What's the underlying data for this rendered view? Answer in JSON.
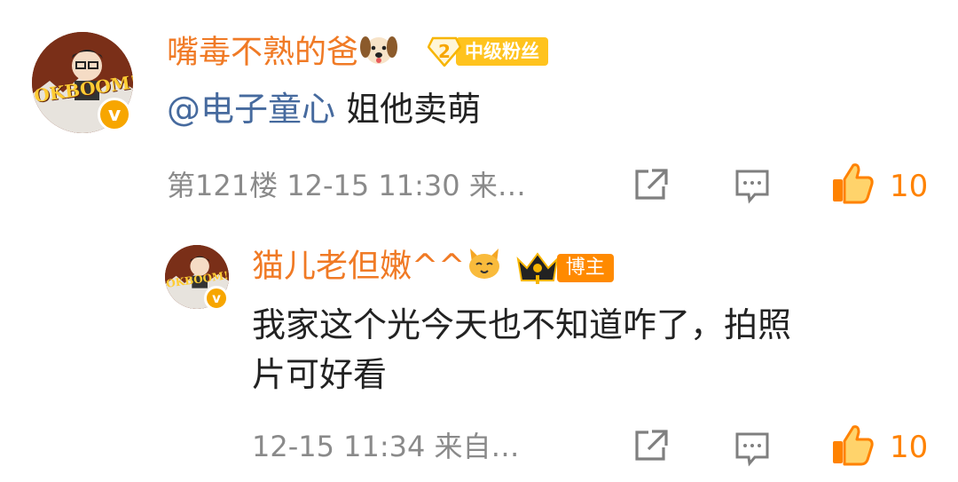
{
  "comment": {
    "username": "嘴毒不熟的爸",
    "avatar_text": "OKBOOM!",
    "fan_badge": {
      "level": "2",
      "label": "中级粉丝"
    },
    "mention": "@电子童心",
    "text": "姐他卖萌",
    "floor": "第121楼",
    "time": "12-15 11:30",
    "source": "来…",
    "likes": "10"
  },
  "reply": {
    "username": "猫儿老但嫩^^",
    "avatar_text": "OKBOOM!",
    "owner_badge": "博主",
    "text_line1": "我家这个光今天也不知道咋了，拍照",
    "text_line2": "片可好看",
    "time": "12-15 11:34",
    "source": "来自…",
    "likes": "10"
  },
  "colors": {
    "username": "#f07a25",
    "mention": "#466a9e",
    "accent": "#ff8200",
    "meta": "#8a8a8a"
  },
  "icons": [
    "share-icon",
    "comment-icon",
    "like-icon",
    "verified-icon",
    "dog-emoji-icon",
    "cat-emoji-icon",
    "crown-icon"
  ]
}
